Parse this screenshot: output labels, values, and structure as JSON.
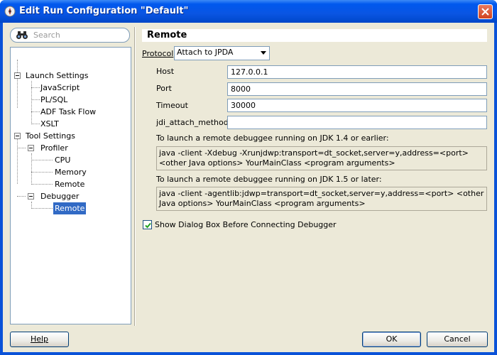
{
  "window": {
    "title": "Edit Run Configuration \"Default\"",
    "titlebar_color": "#0058ee",
    "close_icon": "close-icon"
  },
  "search": {
    "placeholder": "Search",
    "icon": "binoculars-icon"
  },
  "tree": {
    "items": [
      {
        "label": "Launch Settings",
        "level": 0,
        "expanded": true
      },
      {
        "label": "JavaScript",
        "level": 1
      },
      {
        "label": "PL/SQL",
        "level": 1
      },
      {
        "label": "ADF Task Flow",
        "level": 1
      },
      {
        "label": "XSLT",
        "level": 1
      },
      {
        "label": "Tool Settings",
        "level": 0,
        "expanded": true
      },
      {
        "label": "Profiler",
        "level": 1,
        "expanded": true
      },
      {
        "label": "CPU",
        "level": 2
      },
      {
        "label": "Memory",
        "level": 2
      },
      {
        "label": "Remote",
        "level": 2
      },
      {
        "label": "Debugger",
        "level": 1,
        "expanded": true
      },
      {
        "label": "Remote",
        "level": 2,
        "selected": true
      }
    ],
    "selection_color": "#316ac5"
  },
  "panel": {
    "title": "Remote",
    "protocol_label": "Protocol",
    "protocol_value": "Attach to JPDA",
    "host_label": "Host",
    "host_value": "127.0.0.1",
    "port_label": "Port",
    "port_value": "8000",
    "timeout_label": "Timeout",
    "timeout_value": "30000",
    "jdi_label": "jdi_attach_method:",
    "jdi_value": "",
    "jdk14_heading": "To launch a remote debuggee running on JDK 1.4 or earlier:",
    "jdk14_command": "java -client -Xdebug -Xrunjdwp:transport=dt_socket,server=y,address=<port> <other Java options> YourMainClass <program arguments>",
    "jdk15_heading": "To launch a remote debuggee running on JDK 1.5 or later:",
    "jdk15_command": "java -client -agentlib:jdwp=transport=dt_socket,server=y,address=<port> <other Java options> YourMainClass <program arguments>",
    "show_dialog_label": "Show Dialog Box Before Connecting Debugger",
    "show_dialog_checked": true
  },
  "buttons": {
    "help": "Help",
    "ok": "OK",
    "cancel": "Cancel"
  }
}
